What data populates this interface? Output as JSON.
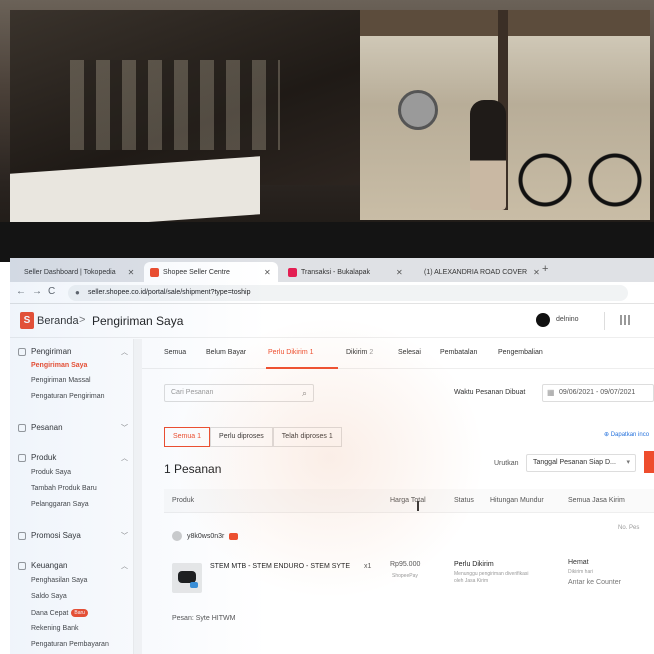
{
  "browser": {
    "tabs": [
      {
        "label": "Seller Dashboard | Tokopedia",
        "color": "#42b549"
      },
      {
        "label": "Shopee Seller Centre",
        "color": "#ee4d2d"
      },
      {
        "label": "Transaksi - Bukalapak",
        "color": "#e31e52"
      },
      {
        "label": "(1) ALEXANDRIA ROAD COVER",
        "color": "#ff0000"
      }
    ],
    "new_tab": "+",
    "url": "seller.shopee.co.id/portal/sale/shipment?type=toship"
  },
  "header": {
    "logo": "S",
    "breadcrumb_home": "Beranda",
    "breadcrumb_sep": ">",
    "page_title": "Pengiriman Saya",
    "username": "delnino"
  },
  "sidebar": {
    "sections": [
      {
        "title": "Pengiriman",
        "items": [
          "Pengiriman Saya",
          "Pengiriman Massal",
          "Pengaturan Pengiriman"
        ]
      },
      {
        "title": "Pesanan",
        "items": []
      },
      {
        "title": "Produk",
        "items": [
          "Produk Saya",
          "Tambah Produk Baru",
          "Pelanggaran Saya"
        ]
      },
      {
        "title": "Promosi Saya",
        "items": []
      },
      {
        "title": "Keuangan",
        "items": [
          "Penghasilan Saya",
          "Saldo Saya",
          "Dana Cepat",
          "Rekening Bank",
          "Pengaturan Pembayaran"
        ]
      }
    ],
    "dana_cepat_badge": "Baru"
  },
  "status_tabs": [
    {
      "label": "Semua",
      "count": ""
    },
    {
      "label": "Belum Bayar",
      "count": ""
    },
    {
      "label": "Perlu Dikirim",
      "count": "1"
    },
    {
      "label": "Dikirim",
      "count": "2"
    },
    {
      "label": "Selesai",
      "count": ""
    },
    {
      "label": "Pembatalan",
      "count": ""
    },
    {
      "label": "Pengembalian",
      "count": ""
    }
  ],
  "search": {
    "placeholder": "Cari Pesanan"
  },
  "date_filter": {
    "label": "Waktu Pesanan Dibuat",
    "range": "09/06/2021 - 09/07/2021"
  },
  "sub_tabs": [
    {
      "label": "Semua",
      "count": "1"
    },
    {
      "label": "Perlu diproses",
      "count": ""
    },
    {
      "label": "Telah diproses",
      "count": "1"
    }
  ],
  "download_link": "Dapatkan inco",
  "order_count": "1 Pesanan",
  "sort": {
    "label": "Urutkan",
    "value": "Tanggal Pesanan Siap D..."
  },
  "table_headers": [
    "Produk",
    "Harga Total",
    "Status",
    "Hitungan Mundur",
    "Semua Jasa Kirim"
  ],
  "order": {
    "buyer": "y8k0ws0n3r",
    "order_no": "No. Pes",
    "product_name": "STEM MTB - STEM ENDURO - STEM SYTE",
    "qty": "x1",
    "price": "Rp95.000",
    "payment": "ShopeePay",
    "status": "Perlu Dikirim",
    "status_note": "Menunggu pengiriman diverifikasi oleh Jasa Kirim",
    "countdown": "Hemat",
    "countdown_sub": "Dikirim hari",
    "shipping": "Antar ke Counter",
    "note": "Pesan: Syte HITWM"
  }
}
